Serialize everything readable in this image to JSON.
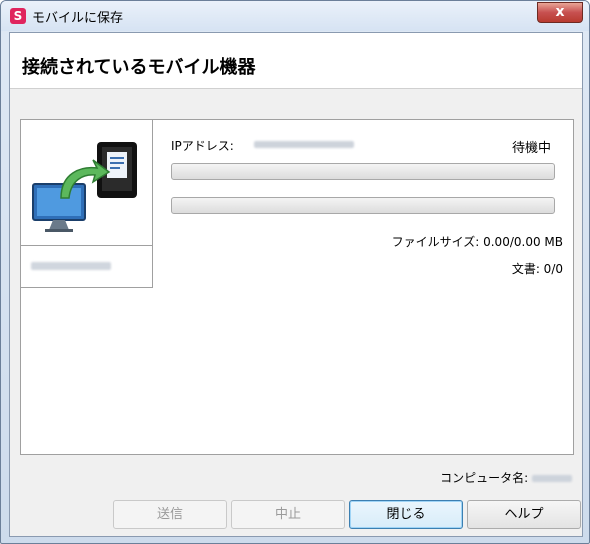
{
  "window": {
    "title": "モバイルに保存",
    "app_icon_letter": "S",
    "close_glyph": "x"
  },
  "header": {
    "title": "接続されているモバイル機器"
  },
  "device": {
    "progress_1": 0,
    "progress_2": 0
  },
  "details": {
    "ip_label": "IPアドレス:",
    "status": "待機中",
    "file_size": "ファイルサイズ: 0.00/0.00 MB",
    "documents": "文書: 0/0"
  },
  "footer": {
    "computer_label": "コンピュータ名:"
  },
  "buttons": {
    "send": "送信",
    "stop": "中止",
    "close": "閉じる",
    "help": "ヘルプ"
  },
  "colors": {
    "accent": "#3c7fb1",
    "app_icon": "#e0245e",
    "close_button": "#c75050"
  }
}
